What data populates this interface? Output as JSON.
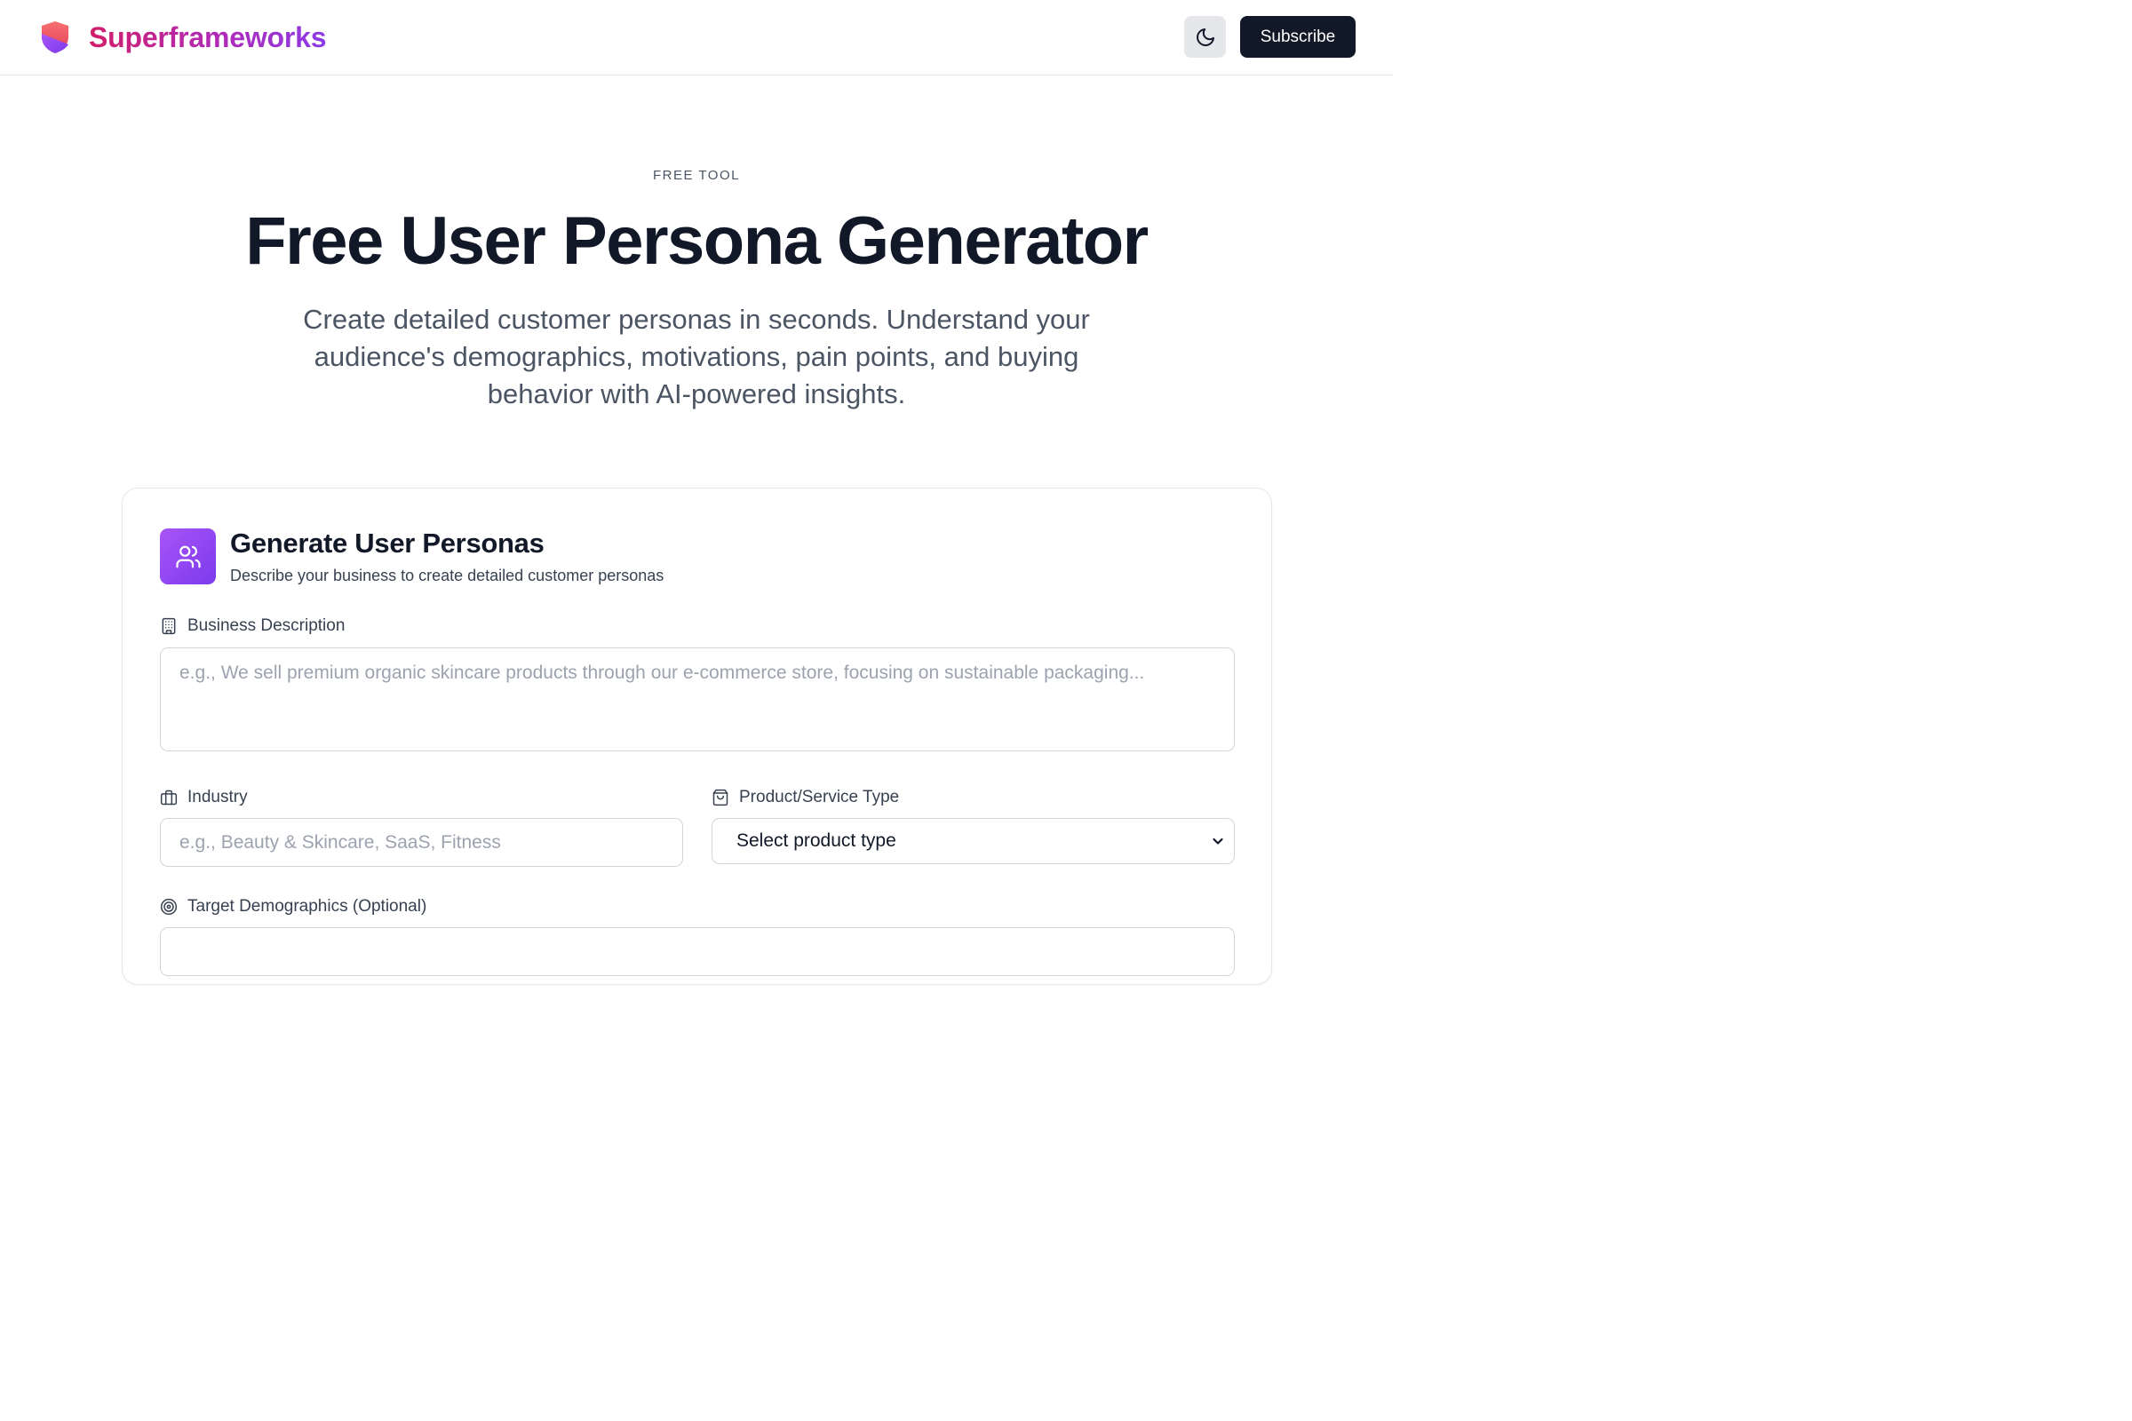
{
  "header": {
    "brand_name": "Superframeworks",
    "subscribe_label": "Subscribe",
    "logo_icon": "shield-logo",
    "theme_icon": "moon-icon"
  },
  "hero": {
    "eyebrow": "FREE TOOL",
    "title": "Free User Persona Generator",
    "subtitle": "Create detailed customer personas in seconds. Understand your audience's demographics, motivations, pain points, and buying behavior with AI-powered insights."
  },
  "form": {
    "title": "Generate User Personas",
    "subtitle": "Describe your business to create detailed customer personas",
    "icon": "users-icon",
    "business_description": {
      "label": "Business Description",
      "icon": "building-icon",
      "placeholder": "e.g., We sell premium organic skincare products through our e-commerce store, focusing on sustainable packaging...",
      "value": ""
    },
    "industry": {
      "label": "Industry",
      "icon": "briefcase-icon",
      "placeholder": "e.g., Beauty & Skincare, SaaS, Fitness",
      "value": ""
    },
    "product_type": {
      "label": "Product/Service Type",
      "icon": "shopping-bag-icon",
      "selected": "Select product type"
    },
    "target_demographics": {
      "label": "Target Demographics (Optional)",
      "icon": "target-icon"
    }
  },
  "colors": {
    "brand_gradient_start": "#d11f6a",
    "brand_gradient_end": "#8b3be6",
    "primary_button": "#111827",
    "card_icon_bg": "#8b5cf6"
  }
}
